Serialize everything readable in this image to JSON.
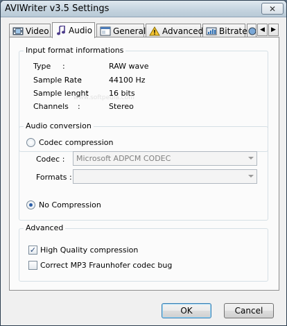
{
  "window": {
    "title": "AVIWriter v3.5 Settings",
    "close_symbol": "✕"
  },
  "tabs": [
    {
      "label": "Video",
      "icon": "film-icon"
    },
    {
      "label": "Audio",
      "icon": "music-note-icon",
      "active": true
    },
    {
      "label": "General",
      "icon": "window-icon"
    },
    {
      "label": "Advanced",
      "icon": "warning-icon"
    },
    {
      "label": "Bitrate",
      "icon": "bitrate-icon"
    }
  ],
  "tab_scroll": {
    "left": "◀",
    "right": "▶"
  },
  "input_format": {
    "title": "Input format informations",
    "rows": [
      {
        "label": "Type",
        "sep": ":",
        "value": "RAW wave"
      },
      {
        "label": "Sample Rate",
        "sep": ":",
        "value": "44100 Hz"
      },
      {
        "label": "Sample lenght",
        "sep": ":",
        "value": "16 bits"
      },
      {
        "label": "Channels",
        "sep": ":",
        "value": "Stereo"
      }
    ]
  },
  "audio_conversion": {
    "title": "Audio conversion",
    "codec_compression_label": "Codec compression",
    "codec_label": "Codec :",
    "codec_value": "Microsoft ADPCM CODEC",
    "formats_label": "Formats :",
    "formats_value": "",
    "no_compression_label": "No Compression",
    "selected": "No Compression"
  },
  "advanced": {
    "title": "Advanced",
    "high_quality_label": "High Quality compression",
    "high_quality_checked": true,
    "mp3_bug_label": "Correct MP3 Fraunhofer codec bug",
    "mp3_bug_checked": false
  },
  "buttons": {
    "ok": "OK",
    "cancel": "Cancel"
  },
  "watermark": "www.softpedia.com"
}
